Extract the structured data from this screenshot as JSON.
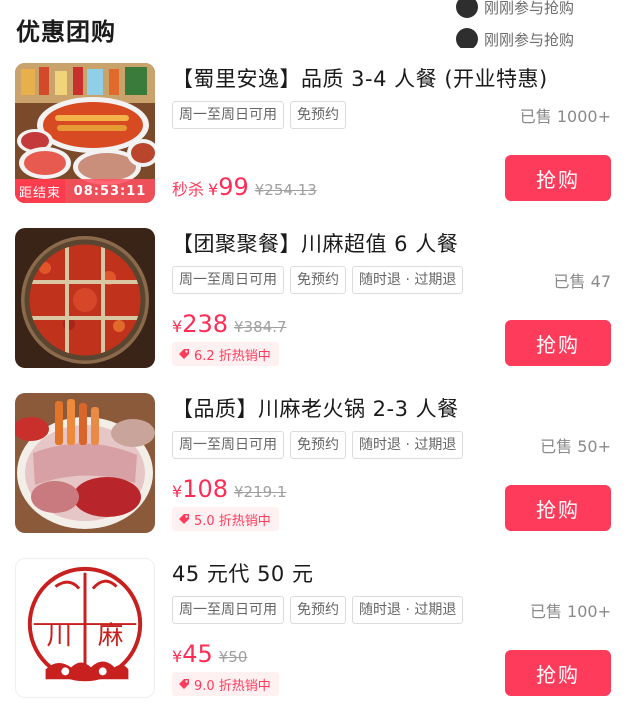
{
  "section": {
    "title": "优惠团购"
  },
  "ticker": {
    "rows": [
      {
        "text": "刚刚参与抢购"
      },
      {
        "text": "刚刚参与抢购"
      }
    ]
  },
  "deals": [
    {
      "title": "【蜀里安逸】品质 3-4 人餐 (开业特惠)",
      "tags": [
        "周一至周日可用",
        "免预约"
      ],
      "sold": "已售 1000+",
      "flash_label": "秒杀",
      "currency": "¥",
      "price": "99",
      "original_price": "¥254.13",
      "countdown_label": "距结束",
      "countdown_time": "08:53:11",
      "buy_label": "抢购"
    },
    {
      "title": "【团聚聚餐】川麻超值 6 人餐",
      "tags": [
        "周一至周日可用",
        "免预约",
        "随时退 · 过期退"
      ],
      "sold": "已售 47",
      "currency": "¥",
      "price": "238",
      "original_price": "¥384.7",
      "hot_badge": "6.2 折热销中",
      "buy_label": "抢购"
    },
    {
      "title": "【品质】川麻老火锅 2-3 人餐",
      "tags": [
        "周一至周日可用",
        "免预约",
        "随时退 · 过期退"
      ],
      "sold": "已售 50+",
      "currency": "¥",
      "price": "108",
      "original_price": "¥219.1",
      "hot_badge": "5.0 折热销中",
      "buy_label": "抢购"
    },
    {
      "title": "45 元代 50 元",
      "tags": [
        "周一至周日可用",
        "免预约",
        "随时退 · 过期退"
      ],
      "sold": "已售 100+",
      "currency": "¥",
      "price": "45",
      "original_price": "¥50",
      "hot_badge": "9.0 折热销中",
      "buy_label": "抢购",
      "logo_text": {
        "left": "川",
        "right": "麻"
      }
    }
  ],
  "colors": {
    "accent": "#ff3b5c",
    "badge_bg": "#fff0f2",
    "tag_border": "#dcdcdc",
    "muted_text": "#8a8a8a"
  },
  "icons": {
    "ticker_avatar": "avatar-icon",
    "hot_badge": "price-tag-icon"
  }
}
